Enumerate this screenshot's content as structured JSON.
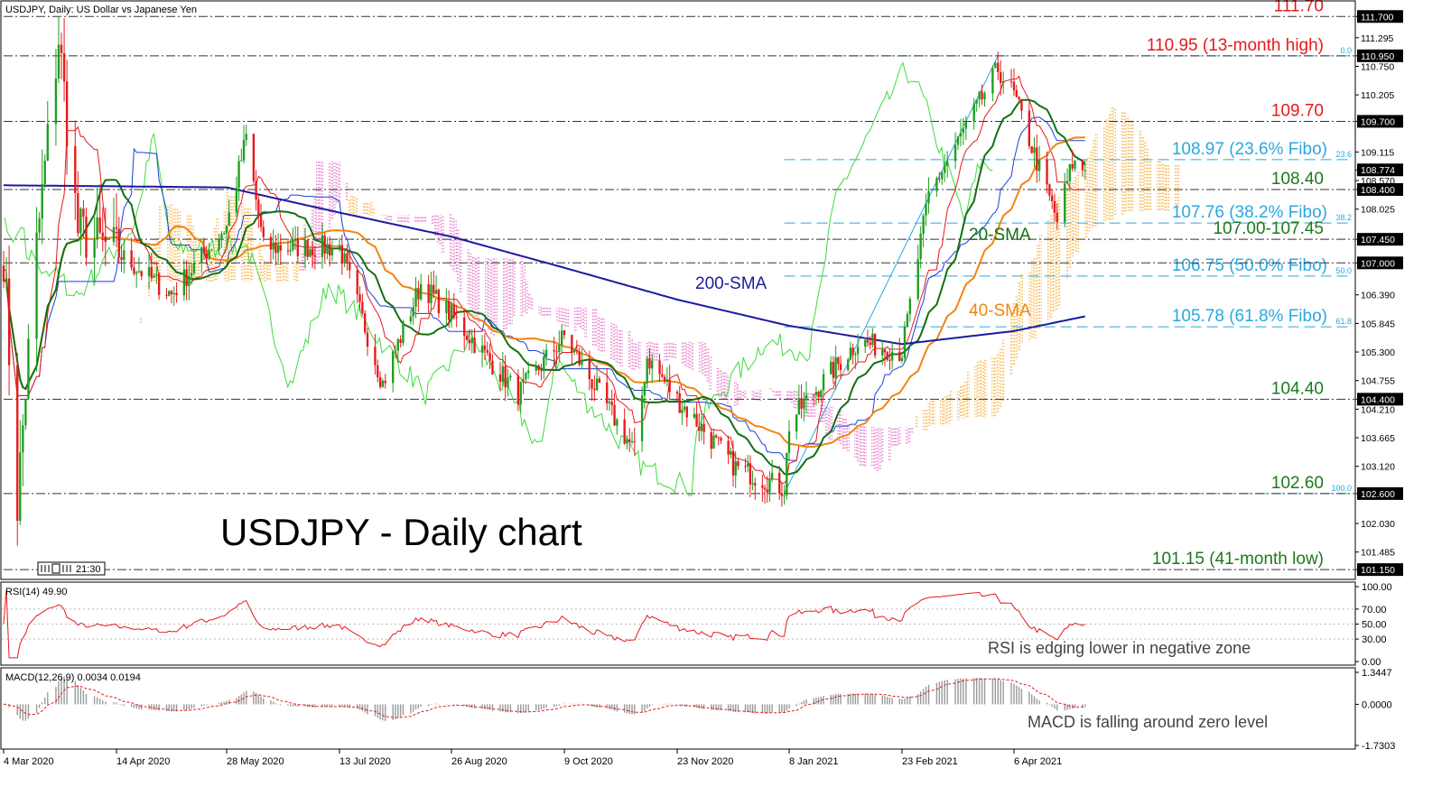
{
  "window": {
    "title": "USDJPY, Daily:  US Dollar vs Japanese Yen",
    "time_badge": "21:30",
    "headline": "USDJPY - Daily chart"
  },
  "colors": {
    "candle_up": "#1e9e1e",
    "candle_down": "#e8191a",
    "sma20": "#127012",
    "sma40": "#f2840f",
    "sma200": "#1a1aa0",
    "tenkan": "#e8191a",
    "kijun": "#1b3fd8",
    "chikou": "#3ddc3d",
    "cloud_bull": "#f5a623",
    "cloud_bear": "#e060c0",
    "fibo": "#29a8e0",
    "level_red": "#e8191a",
    "level_green": "#1b7a1b",
    "rsi": "#e8191a",
    "macd_hist": "#9a9a9a",
    "macd_signal": "#e8191a"
  },
  "main_panel": {
    "price_ticks": [
      "111.700",
      "111.295",
      "110.950",
      "110.750",
      "110.205",
      "109.700",
      "109.115",
      "108.774",
      "108.570",
      "108.400",
      "108.025",
      "107.450",
      "107.000",
      "106.390",
      "105.845",
      "105.300",
      "104.755",
      "104.400",
      "104.210",
      "103.665",
      "103.120",
      "102.600",
      "102.030",
      "101.485",
      "101.150"
    ],
    "highlight_ticks": [
      "111.700",
      "110.950",
      "109.700",
      "108.774",
      "108.400",
      "107.450",
      "107.000",
      "104.400",
      "102.600",
      "101.150"
    ],
    "levels": [
      {
        "price": 111.7,
        "label": "111.70",
        "color": "red",
        "style": "dashdot"
      },
      {
        "price": 110.95,
        "label": "110.95 (13-month high)",
        "color": "red",
        "style": "dashdot"
      },
      {
        "price": 109.7,
        "label": "109.70",
        "color": "red",
        "style": "dashdot"
      },
      {
        "price": 108.4,
        "label": "108.40",
        "color": "green",
        "style": "dashdot"
      },
      {
        "price": 107.45,
        "label": "107.00-107.45",
        "color": "green",
        "style": "dashdot"
      },
      {
        "price": 107.0,
        "label": "",
        "color": "green",
        "style": "dashdot"
      },
      {
        "price": 104.4,
        "label": "104.40",
        "color": "green",
        "style": "dashdot"
      },
      {
        "price": 102.6,
        "label": "102.60",
        "color": "green",
        "style": "dashdot"
      },
      {
        "price": 101.15,
        "label": "101.15 (41-month low)",
        "color": "green",
        "style": "dashdot"
      }
    ],
    "fibo": [
      {
        "price": 110.95,
        "pct": "0.0",
        "label": ""
      },
      {
        "price": 108.97,
        "pct": "23.6",
        "label": "108.97 (23.6% Fibo)"
      },
      {
        "price": 107.76,
        "pct": "38.2",
        "label": "107.76 (38.2% Fibo)"
      },
      {
        "price": 106.75,
        "pct": "50.0",
        "label": "106.75 (50.0% Fibo)"
      },
      {
        "price": 105.78,
        "pct": "61.8",
        "label": "105.78 (61.8% Fibo)"
      },
      {
        "price": 102.6,
        "pct": "100.0",
        "label": ""
      }
    ],
    "annotations": {
      "sma200": "200-SMA",
      "sma20": "20-SMA",
      "sma40": "40-SMA"
    }
  },
  "rsi_panel": {
    "title": "RSI(14) 49.90",
    "ticks": [
      "100.00",
      "70.00",
      "50.00",
      "30.00",
      "0.00"
    ],
    "note": "RSI is edging lower in negative zone"
  },
  "macd_panel": {
    "title": "MACD(12,26,9) 0.0034 0.0194",
    "ticks": [
      "1.3447",
      "0.0000",
      "-1.7303"
    ],
    "note": "MACD is falling around zero level"
  },
  "x_axis": {
    "dates": [
      "4 Mar 2020",
      "14 Apr 2020",
      "28 May 2020",
      "13 Jul 2020",
      "26 Aug 2020",
      "9 Oct 2020",
      "23 Nov 2020",
      "8 Jan 2021",
      "23 Feb 2021",
      "6 Apr 2021"
    ]
  },
  "chart_data": {
    "type": "candlestick",
    "symbol": "USDJPY",
    "timeframe": "Daily",
    "x_start": "4 Mar 2020",
    "x_end": "4 May 2021",
    "ylim": [
      100.98,
      111.98
    ],
    "close_anchors": [
      {
        "date": "4 Mar 2020",
        "close": 107.2
      },
      {
        "date": "9 Mar 2020",
        "close": 102.4
      },
      {
        "date": "12 Mar 2020",
        "close": 104.6
      },
      {
        "date": "16 Mar 2020",
        "close": 107.3
      },
      {
        "date": "24 Mar 2020",
        "close": 111.3
      },
      {
        "date": "31 Mar 2020",
        "close": 107.6
      },
      {
        "date": "14 Apr 2020",
        "close": 107.2
      },
      {
        "date": "6 May 2020",
        "close": 106.4
      },
      {
        "date": "28 May 2020",
        "close": 107.7
      },
      {
        "date": "5 Jun 2020",
        "close": 109.4
      },
      {
        "date": "12 Jun 2020",
        "close": 107.3
      },
      {
        "date": "13 Jul 2020",
        "close": 107.3
      },
      {
        "date": "30 Jul 2020",
        "close": 104.7
      },
      {
        "date": "14 Aug 2020",
        "close": 106.6
      },
      {
        "date": "26 Aug 2020",
        "close": 106.0
      },
      {
        "date": "21 Sep 2020",
        "close": 104.5
      },
      {
        "date": "9 Oct 2020",
        "close": 105.6
      },
      {
        "date": "6 Nov 2020",
        "close": 103.4
      },
      {
        "date": "11 Nov 2020",
        "close": 105.2
      },
      {
        "date": "23 Nov 2020",
        "close": 104.4
      },
      {
        "date": "17 Dec 2020",
        "close": 103.1
      },
      {
        "date": "6 Jan 2021",
        "close": 102.7
      },
      {
        "date": "12 Jan 2021",
        "close": 104.2
      },
      {
        "date": "8 Jan 2021",
        "close": 103.9
      },
      {
        "date": "5 Feb 2021",
        "close": 105.5
      },
      {
        "date": "23 Feb 2021",
        "close": 105.3
      },
      {
        "date": "5 Mar 2021",
        "close": 108.3
      },
      {
        "date": "31 Mar 2021",
        "close": 110.7
      },
      {
        "date": "6 Apr 2021",
        "close": 110.2
      },
      {
        "date": "23 Apr 2021",
        "close": 107.8
      },
      {
        "date": "29 Apr 2021",
        "close": 108.9
      },
      {
        "date": "4 May 2021",
        "close": 108.77
      }
    ],
    "sma200_anchors": [
      {
        "date": "4 Mar 2020",
        "value": 108.48
      },
      {
        "date": "28 May 2020",
        "value": 108.44
      },
      {
        "date": "26 Aug 2020",
        "value": 107.5
      },
      {
        "date": "23 Nov 2020",
        "value": 106.3
      },
      {
        "date": "8 Jan 2021",
        "value": 105.8
      },
      {
        "date": "23 Feb 2021",
        "value": 105.45
      },
      {
        "date": "6 Apr 2021",
        "value": 105.7
      },
      {
        "date": "4 May 2021",
        "value": 105.98
      }
    ],
    "rsi": {
      "last": 49.9,
      "levels": [
        70,
        50,
        30
      ]
    },
    "macd": {
      "macd": 0.0034,
      "signal": 0.0194
    }
  }
}
